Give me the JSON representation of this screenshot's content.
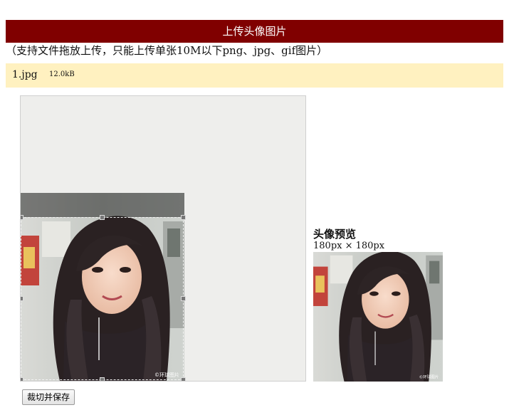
{
  "header": {
    "title": "上传头像图片"
  },
  "subtitle": "（支持文件拖放上传，只能上传单张10M以下png、jpg、gif图片）",
  "file": {
    "name": "1.jpg",
    "size": "12.0kB"
  },
  "preview": {
    "title": "头像预览",
    "size": "180px × 180px"
  },
  "actions": {
    "crop_save_label": "裁切并保存"
  },
  "photo": {
    "watermark": "©环球图片"
  },
  "colors": {
    "header_bg": "#800000",
    "file_bar_bg": "#fff1c0",
    "stage_bg": "#eeeeec"
  }
}
